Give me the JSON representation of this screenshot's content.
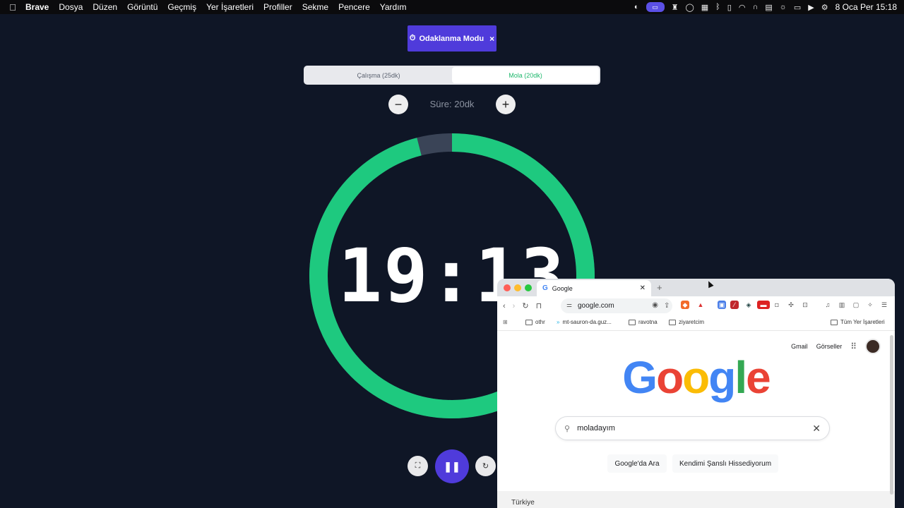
{
  "menubar": {
    "apple": "",
    "items": [
      "Brave",
      "Dosya",
      "Düzen",
      "Görüntü",
      "Geçmiş",
      "Yer İşaretleri",
      "Profiller",
      "Sekme",
      "Pencere",
      "Yardım"
    ],
    "clock": "8 Oca Per  15:18"
  },
  "focus": {
    "badge_icon": "⏱",
    "badge_label": "Odaklanma Modu",
    "badge_close": "×",
    "tabs": [
      {
        "label": "Çalışma (25dk)",
        "active": false
      },
      {
        "label": "Mola (20dk)",
        "active": true
      }
    ],
    "duration_label": "Süre: 20dk",
    "minus": "−",
    "plus": "+",
    "timer": "19:13",
    "progress": 0.96,
    "colors": {
      "accent": "#4f3bdb",
      "ring": "#1ec97f",
      "track": "#3a4457",
      "bg": "#0f1626"
    }
  },
  "controls": {
    "fullscreen": "⛶",
    "pause": "❚❚",
    "reset": "↻"
  },
  "browser": {
    "tab_title": "Google",
    "tab_icon": "G",
    "tab_close": "✕",
    "new_tab": "+",
    "url": "google.com",
    "bookmarks": [
      "othr",
      "mt-sauron-da.guz...",
      "ravotna",
      "ziyaretcim"
    ],
    "all_bookmarks": "Tüm Yer İşaretleri",
    "google": {
      "gmail": "Gmail",
      "images": "Görseller",
      "search_value": "moladayım",
      "btn_search": "Google'da Ara",
      "btn_lucky": "Kendimi Şanslı Hissediyorum",
      "country": "Türkiye"
    }
  }
}
